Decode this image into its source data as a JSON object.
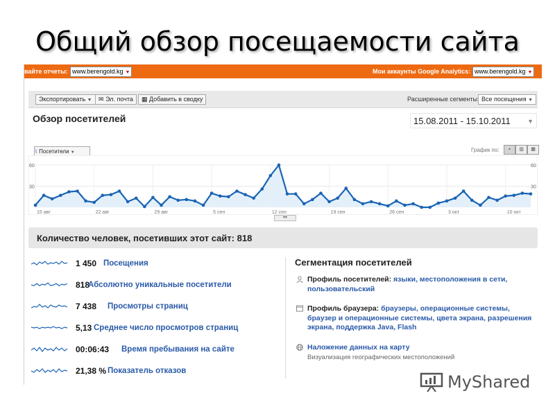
{
  "slide": {
    "title": "Общий обзор посещаемости сайта"
  },
  "orange_bar": {
    "reports_label": "вайте отчеты:",
    "reports_site": "www.berengold.kg",
    "accounts_label": "Мои аккаунты Google Analytics:",
    "accounts_site": "www.berengold.kg"
  },
  "toolbar": {
    "export_label": "Экспортировать",
    "email_label": "Эл. почта",
    "add_to_dashboard_label": "Добавить в сводку",
    "advanced_segments_label": "Расширенные сегменты:",
    "segment_value": "Все посещения"
  },
  "overview": {
    "title": "Обзор посетителей",
    "date_range": "15.08.2011 - 15.10.2011",
    "metric_select": "Посетители",
    "graph_by_label": "График по:"
  },
  "chart_data": {
    "type": "line",
    "ylim": [
      0,
      60
    ],
    "y_ticks_left": [
      "60",
      "30"
    ],
    "y_ticks_right": [
      "60",
      "30"
    ],
    "x_tick_labels": [
      "15 авг",
      "22 авг",
      "29 авг",
      "5 сен",
      "12 сен",
      "19 сен",
      "26 сен",
      "3 окт",
      "10 окт"
    ],
    "series": [
      {
        "values": [
          3,
          17,
          12,
          17,
          22,
          23,
          9,
          7,
          17,
          18,
          23,
          8,
          13,
          1,
          14,
          3,
          15,
          10,
          11,
          9,
          3,
          20,
          16,
          15,
          23,
          18,
          13,
          26,
          45,
          60,
          19,
          19,
          5,
          11,
          20,
          8,
          13,
          27,
          11,
          5,
          8,
          5,
          2,
          9,
          3,
          5,
          0,
          0,
          6,
          9,
          13,
          23,
          10,
          3,
          14,
          10,
          16,
          17,
          20,
          19
        ],
        "color": "#1a63b4"
      }
    ]
  },
  "summary": {
    "text": "Количество человек, посетивших этот сайт: 818"
  },
  "metrics": [
    {
      "value": "1 450",
      "label": "Посещения"
    },
    {
      "value": "818",
      "label": "Абсолютно уникальные посетители"
    },
    {
      "value": "7 438",
      "label": "Просмотры страниц"
    },
    {
      "value": "5,13",
      "label": "Среднее число просмотров страниц"
    },
    {
      "value": "00:06:43",
      "label": "Время пребывания на сайте"
    },
    {
      "value": "21,38 %",
      "label": "Показатель отказов"
    }
  ],
  "segmentation": {
    "title": "Сегментация посетителей",
    "visitor_profile": {
      "heading": "Профиль посетителей:",
      "links": [
        "языки,",
        "местоположения в сети,",
        "пользовательский"
      ]
    },
    "browser_profile": {
      "heading": "Профиль браузера:",
      "links": [
        "браузеры,",
        "операционные системы,",
        "браузер и операционные системы,",
        "цвета экрана,",
        "разрешения экрана,",
        "поддержка Java,",
        "Flash"
      ]
    },
    "map_overlay": {
      "link": "Наложение данных на карту",
      "description": "Визуализация географических местоположений"
    }
  },
  "watermark": {
    "text": "MyShared"
  },
  "colors": {
    "orange": "#ee6a12",
    "link": "#2a5aa8",
    "line": "#1a63b4",
    "area": "#e3f0fa"
  }
}
